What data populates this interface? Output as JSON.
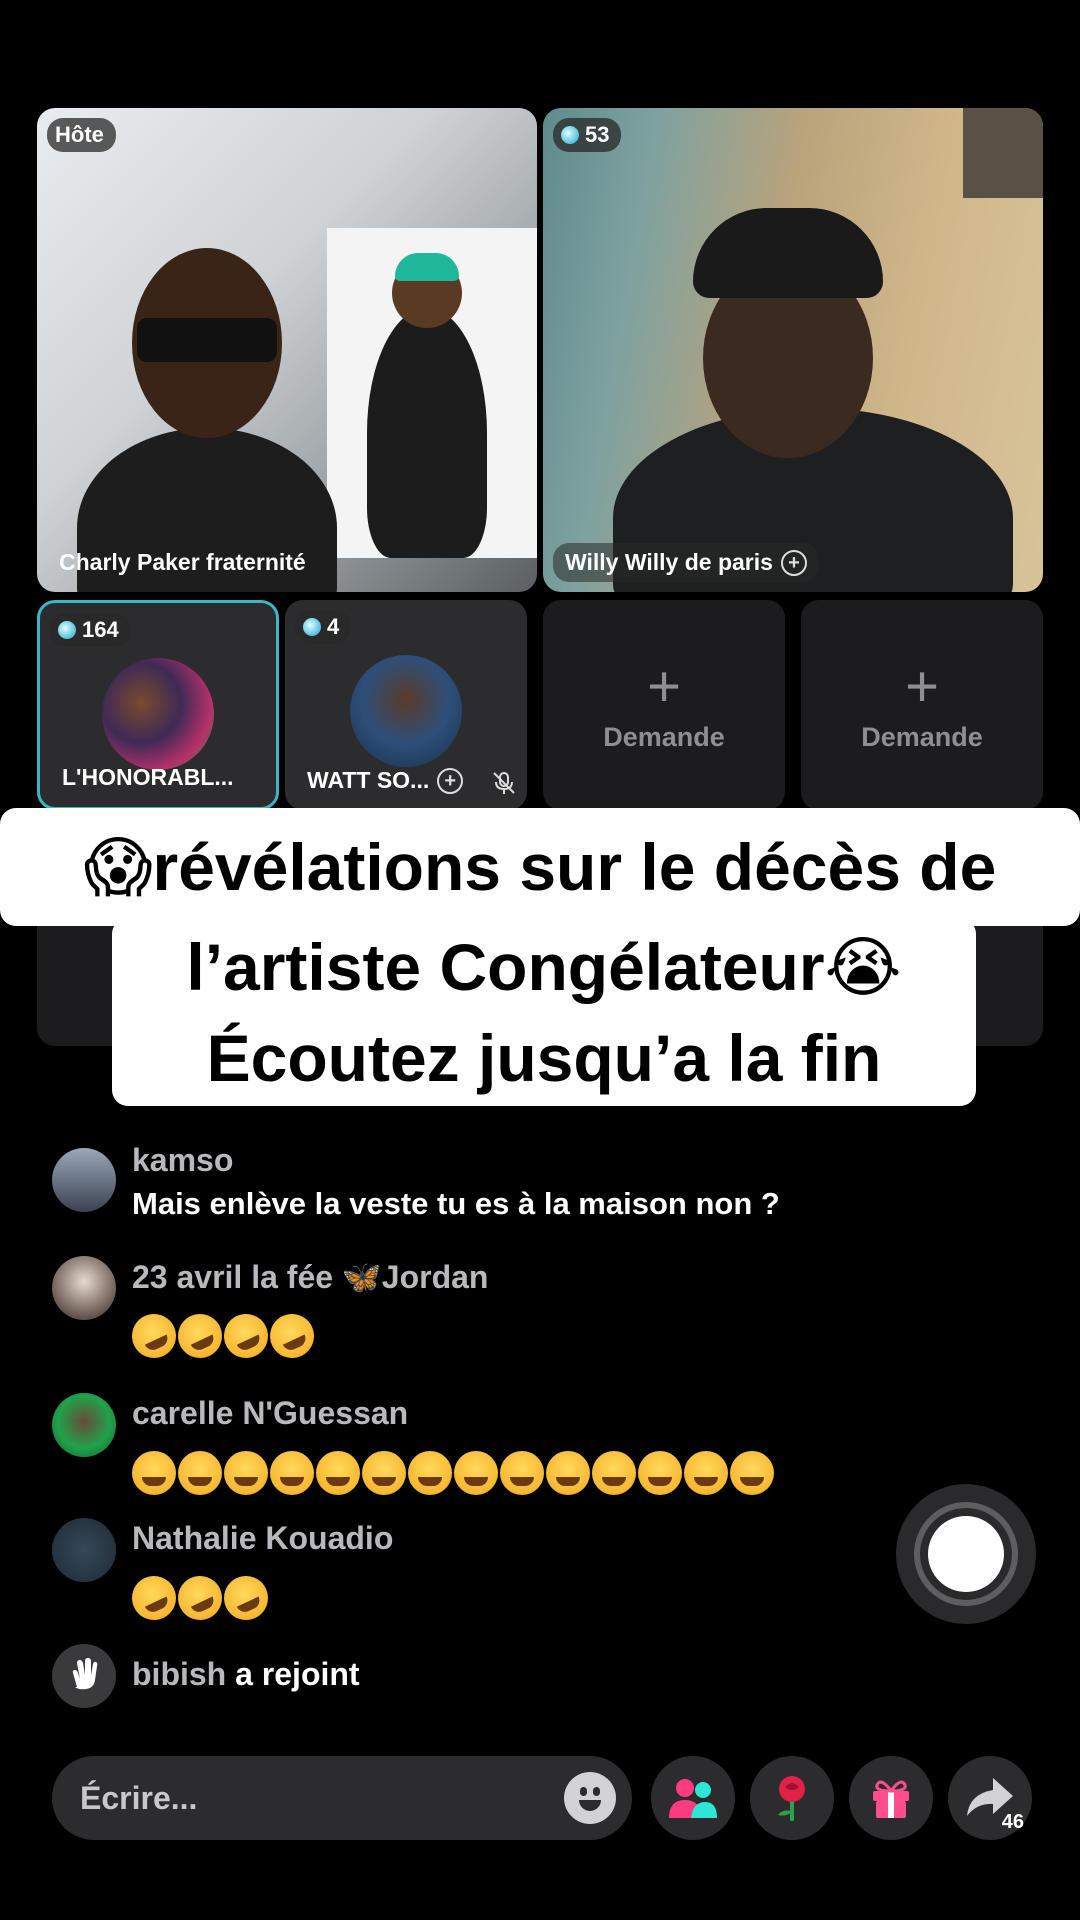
{
  "grid": {
    "host_tile": {
      "badge": "Hôte",
      "name": "Charly Paker fraternité"
    },
    "guest_tile": {
      "count": "53",
      "name": "Willy Willy de paris"
    },
    "small_tiles": [
      {
        "count": "164",
        "name": "L'HONORABL..."
      },
      {
        "count": "4",
        "name": "WATT SO..."
      }
    ],
    "request_label": "Demande"
  },
  "caption": {
    "line1_emoji": "😱",
    "line1": "révélations sur le  décès de",
    "line2": "l’artiste Congélateur",
    "line2_emoji": "😭",
    "line3": "Écoutez jusqu’a la fin"
  },
  "comments": [
    {
      "name": "kamso",
      "text": "Mais enlève la veste tu es à la maison non ?"
    },
    {
      "name": "23 avril la fée 🦋Jordan",
      "emoji_count": 4,
      "emoji": "rofl"
    },
    {
      "name": "carelle N'Guessan",
      "emoji_count": 14,
      "emoji": "joy"
    },
    {
      "name": "Nathalie Kouadio",
      "emoji_count": 3,
      "emoji": "rofl"
    }
  ],
  "joined": {
    "name": "bibish",
    "suffix": " a rejoint"
  },
  "bottom_bar": {
    "placeholder": "Écrire...",
    "share_count": "46"
  },
  "colors": {
    "accent": "#3ab7c7",
    "background": "#000000",
    "input": "#2c2c2e"
  }
}
